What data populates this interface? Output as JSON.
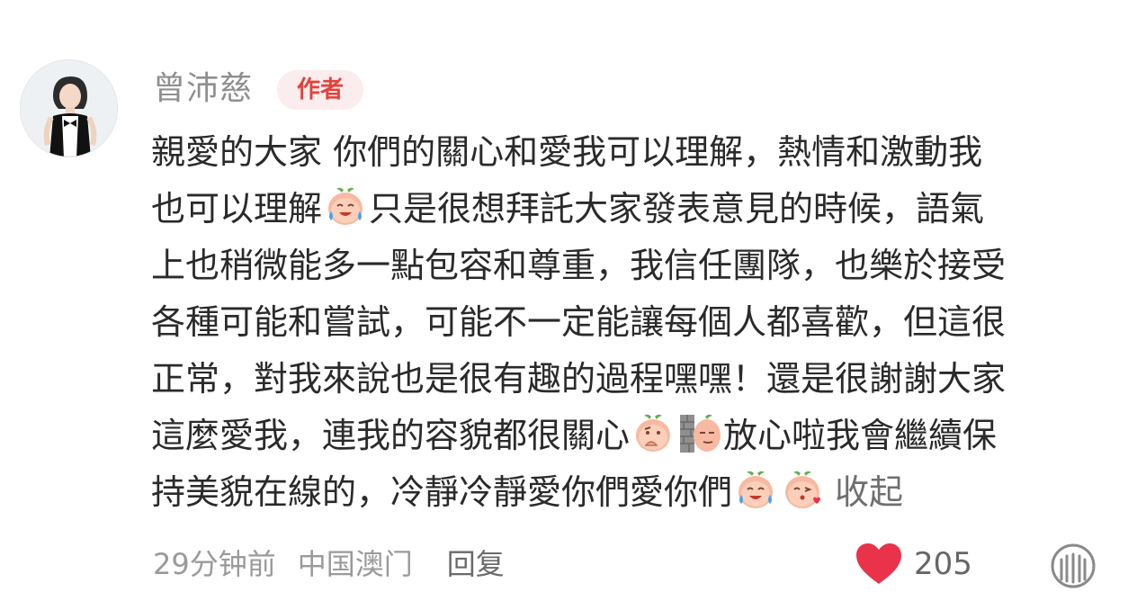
{
  "comment": {
    "username": "曾沛慈",
    "badge": "作者",
    "segments": [
      "親愛的大家 你們的關心和愛我可以理解，熱情和激動我",
      "也可以理解",
      "只是很想拜託大家發表意見的時候，語氣",
      "上也稍微能多一點包容和尊重，我信任團隊，也樂於接受",
      "各種可能和嘗試，可能不一定能讓每個人都喜歡，但這很",
      "正常，對我來說也是很有趣的過程嘿嘿！還是很謝謝大家",
      "這麼愛我，連我的容貌都很關心",
      "放心啦我會繼續保",
      "持美貌在線的，冷靜冷靜愛你們愛你們"
    ],
    "collapse_label": "收起",
    "time": "29分钟前",
    "location": "中国澳门",
    "reply_label": "回复",
    "like_count": "205"
  },
  "icons": {
    "like": "heart-icon",
    "more": "weibo-more-icon",
    "emoji_cry": "crying-laugh-emoji",
    "emoji_think": "thinking-emoji",
    "emoji_peek": "peeking-emoji",
    "emoji_kiss": "kiss-emoji"
  },
  "colors": {
    "badge_text": "#e3423b",
    "badge_bg": "#fbecee",
    "heart": "#e8334a"
  }
}
